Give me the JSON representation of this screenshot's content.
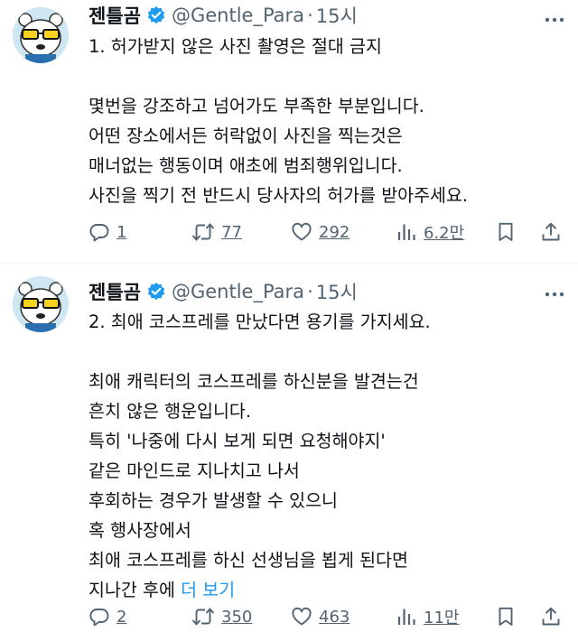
{
  "tweets": [
    {
      "author": {
        "display_name": "젠틀곰",
        "handle": "@Gentle_Para",
        "time": "15시"
      },
      "lines": [
        "1. 허가받지 않은 사진 촬영은 절대 금지",
        "",
        "몇번을 강조하고 넘어가도 부족한 부분입니다.",
        "어떤 장소에서든 허락없이 사진을 찍는것은",
        "매너없는 행동이며 애초에 범죄행위입니다.",
        "사진을 찍기 전 반드시 당사자의 허가를 받아주세요."
      ],
      "show_more": "",
      "stats": {
        "replies": "1",
        "retweets": "77",
        "likes": "292",
        "views": "6.2만"
      }
    },
    {
      "author": {
        "display_name": "젠틀곰",
        "handle": "@Gentle_Para",
        "time": "15시"
      },
      "lines": [
        "2. 최애 코스프레를 만났다면 용기를 가지세요.",
        "",
        "최애 캐릭터의 코스프레를 하신분을 발견는건",
        "흔치 않은 행운입니다.",
        "특히 '나중에 다시 보게 되면 요청해야지'",
        "같은 마인드로 지나치고 나서",
        "후회하는 경우가 발생할 수 있으니",
        "혹 행사장에서",
        "최애 코스프레를 하신 선생님을 뵙게 된다면",
        "지나간 후에"
      ],
      "show_more": "더 보기",
      "stats": {
        "replies": "2",
        "retweets": "350",
        "likes": "463",
        "views": "11만"
      }
    }
  ],
  "icons": {
    "verified": "verified-badge-icon",
    "more": "more-options-icon",
    "reply": "reply-icon",
    "retweet": "retweet-icon",
    "like": "like-icon",
    "views": "views-icon",
    "bookmark": "bookmark-icon",
    "share": "share-icon"
  },
  "colors": {
    "text": "#0f1419",
    "secondary": "#536471",
    "link": "#1d9bf0",
    "verified": "#1d9bf0",
    "divider": "#eff3f4"
  }
}
